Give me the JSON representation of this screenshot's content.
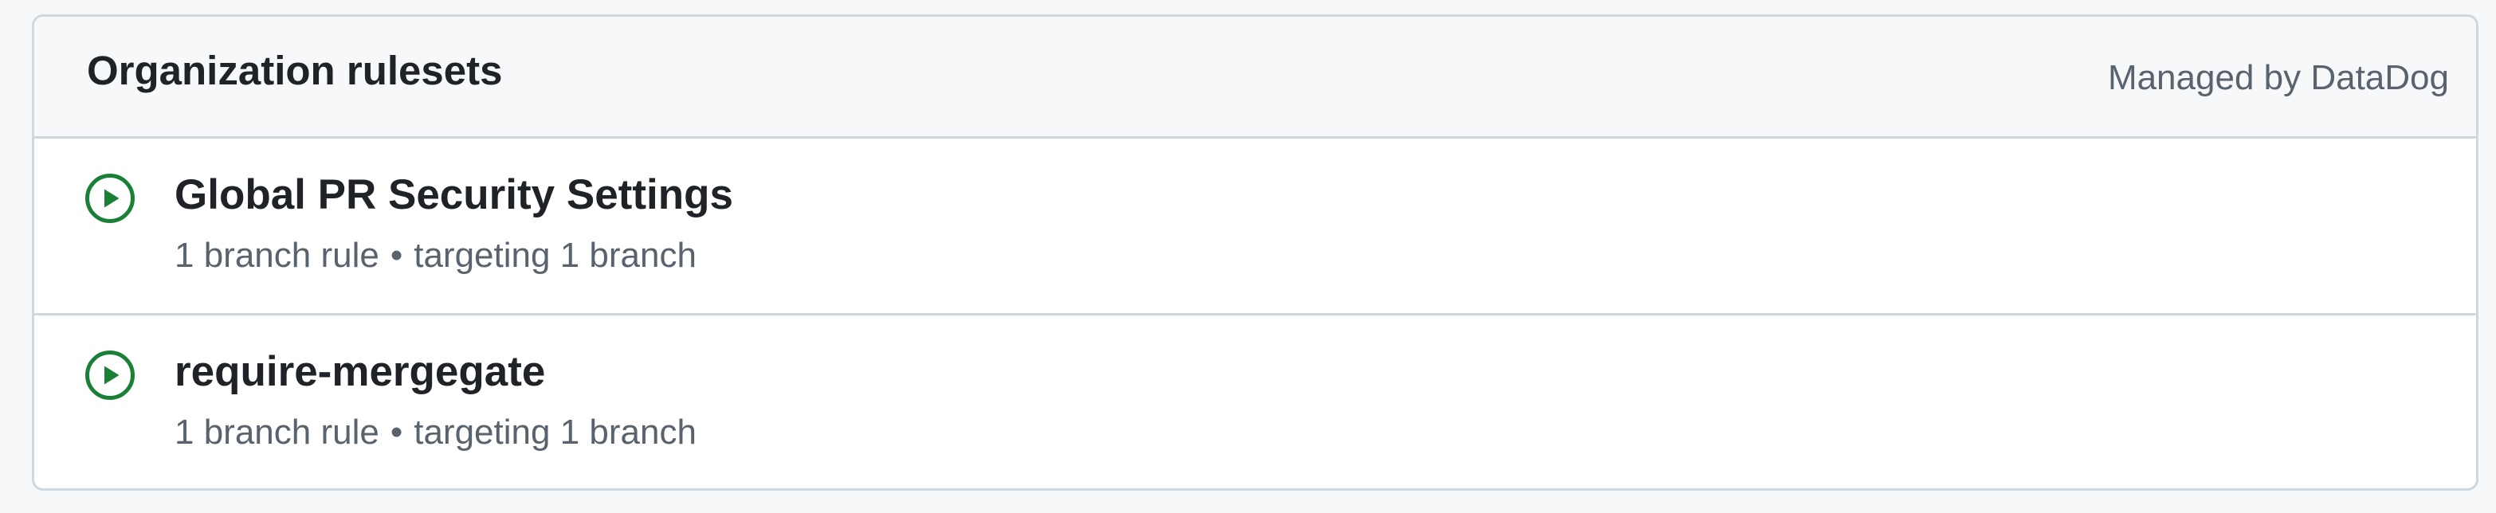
{
  "header": {
    "title": "Organization rulesets",
    "managed_by": "Managed by DataDog"
  },
  "rulesets": [
    {
      "name": "Global PR Security Settings",
      "rules": "1 branch rule",
      "separator": "•",
      "targeting": "targeting 1 branch",
      "status_icon": "play-circle-icon",
      "status_color": "#1a7f37"
    },
    {
      "name": "require-mergegate",
      "rules": "1 branch rule",
      "separator": "•",
      "targeting": "targeting 1 branch",
      "status_icon": "play-circle-icon",
      "status_color": "#1a7f37"
    }
  ]
}
